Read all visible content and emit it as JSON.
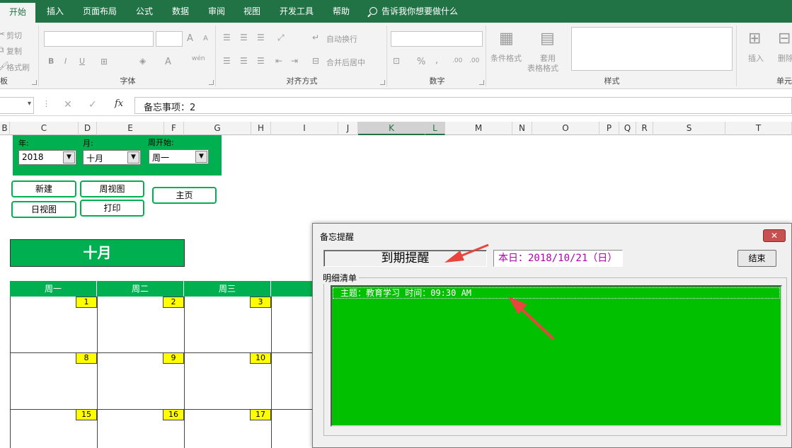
{
  "ribbon": {
    "tabs": [
      "开始",
      "插入",
      "页面布局",
      "公式",
      "数据",
      "审阅",
      "视图",
      "开发工具",
      "帮助"
    ],
    "tell_me": "告诉我你想要做什么",
    "clipboard": {
      "cut": "剪切",
      "copy": "复制",
      "format_painter": "格式刷",
      "label": "板"
    },
    "font": {
      "label": "字体",
      "bold": "B",
      "italic": "I",
      "underline": "U",
      "grow": "A",
      "shrink": "A",
      "font_color": "A",
      "phonetic": "wén"
    },
    "alignment": {
      "label": "对齐方式",
      "wrap_text": "自动换行",
      "merge_center": "合并后居中"
    },
    "number": {
      "label": "数字",
      "percent": "%",
      "comma": ",",
      "inc_decimal": ".00",
      "dec_decimal": ".00"
    },
    "styles": {
      "label": "样式",
      "conditional_format": "条件格式",
      "table_format_line1": "套用",
      "table_format_line2": "表格格式"
    },
    "cells": {
      "label": "单元",
      "insert": "插入",
      "delete": "删除"
    }
  },
  "formula_bar": {
    "fx": "fx",
    "content": "备忘事项：2"
  },
  "columns": [
    "B",
    "C",
    "D",
    "E",
    "F",
    "G",
    "H",
    "I",
    "J",
    "K",
    "L",
    "M",
    "N",
    "O",
    "P",
    "Q",
    "R",
    "S",
    "T"
  ],
  "controls": {
    "year_label": "年:",
    "year_value": "2018",
    "month_label": "月:",
    "month_value": "十月",
    "week_start_label": "周开始:",
    "week_start_value": "周一",
    "buttons": {
      "new": "新建",
      "week_view": "周视图",
      "home": "主页",
      "day_view": "日视图",
      "print": "打印"
    }
  },
  "calendar": {
    "month_title": "十月",
    "day_headers": [
      "周一",
      "周二",
      "周三"
    ],
    "dates": [
      "1",
      "2",
      "3",
      "8",
      "9",
      "10",
      "15",
      "16",
      "17"
    ]
  },
  "dialog": {
    "title": "备忘提醒",
    "close": "✕",
    "due_label": "到期提醒",
    "today_label": "本日：2018/10/21（日）",
    "end_button": "结束",
    "list_title": "明细清单",
    "items": [
      "主题：教育学习  时间：09:30 AM"
    ]
  },
  "colors": {
    "excel_green": "#217346",
    "accent_green": "#00b050",
    "list_green": "#00c000",
    "date_yellow": "#ffff00",
    "today_magenta": "#b000b0",
    "arrow_red": "#e8453c"
  }
}
